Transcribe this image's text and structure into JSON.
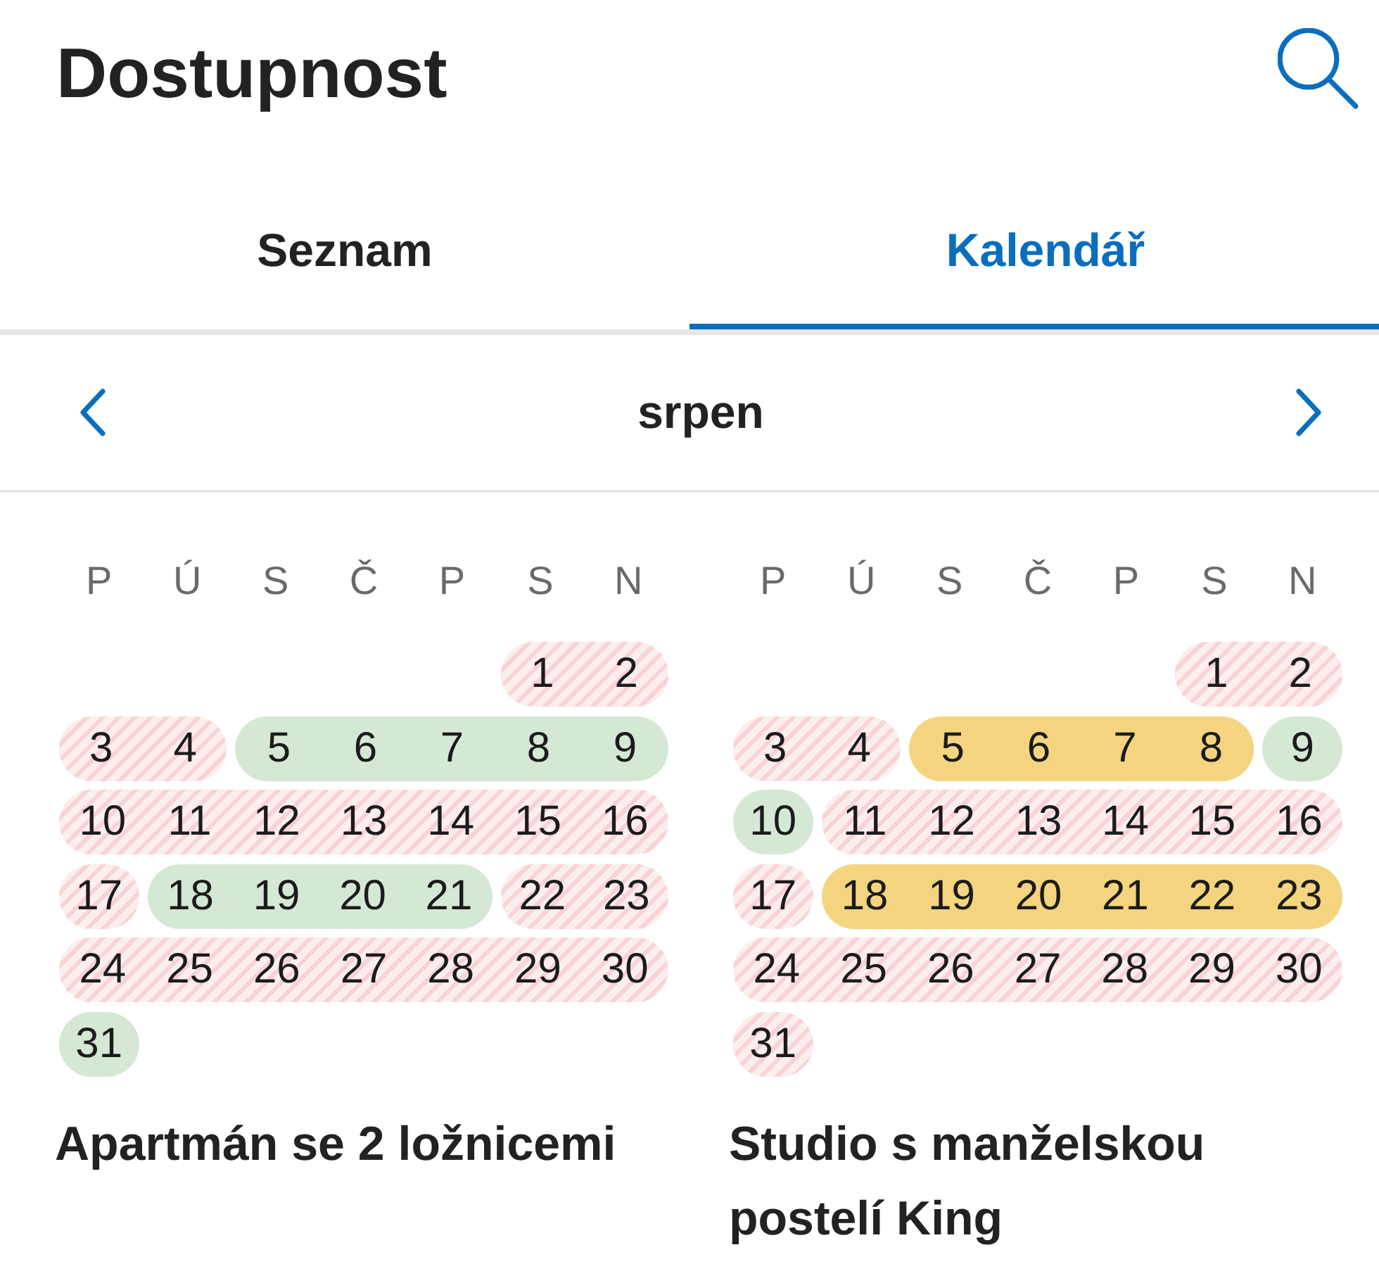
{
  "header": {
    "title": "Dostupnost"
  },
  "tabs": [
    {
      "label": "Seznam",
      "selected": false
    },
    {
      "label": "Kalendář",
      "selected": true
    }
  ],
  "month_nav": {
    "month": "srpen"
  },
  "calendars": [
    {
      "weekdays": [
        "P",
        "Ú",
        "S",
        "Č",
        "P",
        "S",
        "N"
      ],
      "weeks": [
        [
          {
            "day": "1",
            "kind": "booked"
          },
          {
            "day": "2",
            "kind": "booked"
          }
        ],
        [
          {
            "day": "3",
            "kind": "booked"
          },
          {
            "day": "4",
            "kind": "booked"
          },
          {
            "day": "5",
            "kind": "free"
          },
          {
            "day": "6",
            "kind": "free"
          },
          {
            "day": "7",
            "kind": "free"
          },
          {
            "day": "8",
            "kind": "free"
          },
          {
            "day": "9",
            "kind": "free"
          }
        ],
        [
          {
            "day": "10",
            "kind": "booked"
          },
          {
            "day": "11",
            "kind": "booked"
          },
          {
            "day": "12",
            "kind": "booked"
          },
          {
            "day": "13",
            "kind": "booked"
          },
          {
            "day": "14",
            "kind": "booked"
          },
          {
            "day": "15",
            "kind": "booked"
          },
          {
            "day": "16",
            "kind": "booked"
          }
        ],
        [
          {
            "day": "17",
            "kind": "booked"
          },
          {
            "day": "18",
            "kind": "free"
          },
          {
            "day": "19",
            "kind": "free"
          },
          {
            "day": "20",
            "kind": "free"
          },
          {
            "day": "21",
            "kind": "free"
          },
          {
            "day": "22",
            "kind": "booked"
          },
          {
            "day": "23",
            "kind": "booked"
          }
        ],
        [
          {
            "day": "24",
            "kind": "booked"
          },
          {
            "day": "25",
            "kind": "booked"
          },
          {
            "day": "26",
            "kind": "booked"
          },
          {
            "day": "27",
            "kind": "booked"
          },
          {
            "day": "28",
            "kind": "booked"
          },
          {
            "day": "29",
            "kind": "booked"
          },
          {
            "day": "30",
            "kind": "booked"
          }
        ],
        [
          {
            "day": "31",
            "kind": "free"
          }
        ]
      ],
      "title": "Apartmán se 2 ložnicemi"
    },
    {
      "weekdays": [
        "P",
        "Ú",
        "S",
        "Č",
        "P",
        "S",
        "N"
      ],
      "weeks": [
        [
          {
            "day": "1",
            "kind": "booked"
          },
          {
            "day": "2",
            "kind": "booked"
          }
        ],
        [
          {
            "day": "3",
            "kind": "booked"
          },
          {
            "day": "4",
            "kind": "booked"
          },
          {
            "day": "5",
            "kind": "pending"
          },
          {
            "day": "6",
            "kind": "pending"
          },
          {
            "day": "7",
            "kind": "pending"
          },
          {
            "day": "8",
            "kind": "pending"
          },
          {
            "day": "9",
            "kind": "free"
          }
        ],
        [
          {
            "day": "10",
            "kind": "free"
          },
          {
            "day": "11",
            "kind": "booked"
          },
          {
            "day": "12",
            "kind": "booked"
          },
          {
            "day": "13",
            "kind": "booked"
          },
          {
            "day": "14",
            "kind": "booked"
          },
          {
            "day": "15",
            "kind": "booked"
          },
          {
            "day": "16",
            "kind": "booked"
          }
        ],
        [
          {
            "day": "17",
            "kind": "booked"
          },
          {
            "day": "18",
            "kind": "pending"
          },
          {
            "day": "19",
            "kind": "pending"
          },
          {
            "day": "20",
            "kind": "pending"
          },
          {
            "day": "21",
            "kind": "pending"
          },
          {
            "day": "22",
            "kind": "pending"
          },
          {
            "day": "23",
            "kind": "pending"
          }
        ],
        [
          {
            "day": "24",
            "kind": "booked"
          },
          {
            "day": "25",
            "kind": "booked"
          },
          {
            "day": "26",
            "kind": "booked"
          },
          {
            "day": "27",
            "kind": "booked"
          },
          {
            "day": "28",
            "kind": "booked"
          },
          {
            "day": "29",
            "kind": "booked"
          },
          {
            "day": "30",
            "kind": "booked"
          }
        ],
        [
          {
            "day": "31",
            "kind": "booked"
          }
        ]
      ],
      "title": "Studio s manželskou postelí King"
    }
  ]
}
